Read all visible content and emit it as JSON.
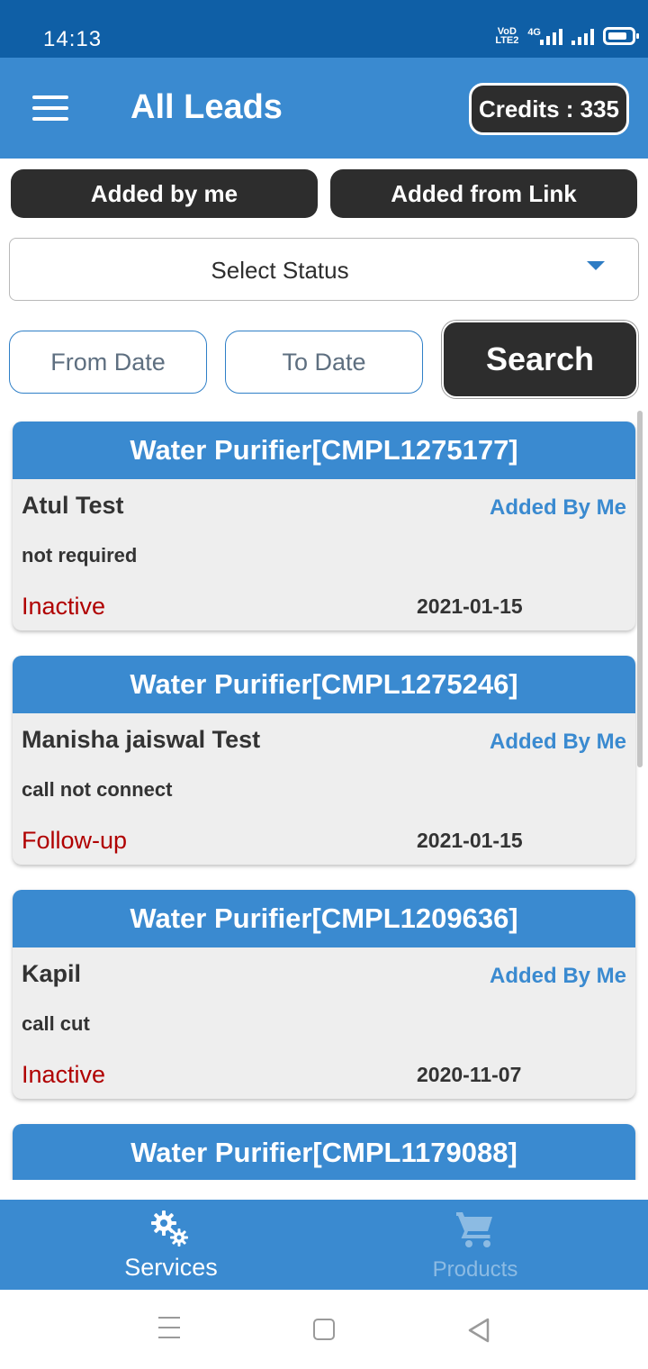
{
  "status_bar": {
    "time": "14:13",
    "network_label": "4G",
    "volte_label": "VoD LTE2"
  },
  "app_bar": {
    "title": "All Leads",
    "credits": "Credits : 335",
    "menu_icon": "hamburger-menu-icon"
  },
  "filters": {
    "added_by_me": "Added by me",
    "added_from_link": "Added from Link",
    "select_status": "Select Status",
    "from_date": "From Date",
    "to_date": "To Date",
    "search": "Search"
  },
  "leads": [
    {
      "product": "Water Purifier[CMPL1275177]",
      "name": "Atul Test",
      "added_by": "Added By Me",
      "remark": "not required",
      "status": "Inactive",
      "date": "2021-01-15"
    },
    {
      "product": "Water Purifier[CMPL1275246]",
      "name": "Manisha jaiswal Test",
      "added_by": "Added By Me",
      "remark": "call not connect",
      "status": "Follow-up",
      "date": "2021-01-15"
    },
    {
      "product": "Water Purifier[CMPL1209636]",
      "name": "Kapil",
      "added_by": "Added By Me",
      "remark": "call cut",
      "status": "Inactive",
      "date": "2020-11-07"
    },
    {
      "product": "Water Purifier[CMPL1179088]",
      "name": "",
      "added_by": "",
      "remark": "",
      "status": "",
      "date": ""
    }
  ],
  "bottom_nav": {
    "services": "Services",
    "products": "Products",
    "services_icon": "gears-icon",
    "products_icon": "cart-icon"
  },
  "colors": {
    "primary": "#3a8ad0",
    "status_bar": "#0f5fa6",
    "dark_button": "#2d2d2d",
    "status_red": "#b00000"
  }
}
